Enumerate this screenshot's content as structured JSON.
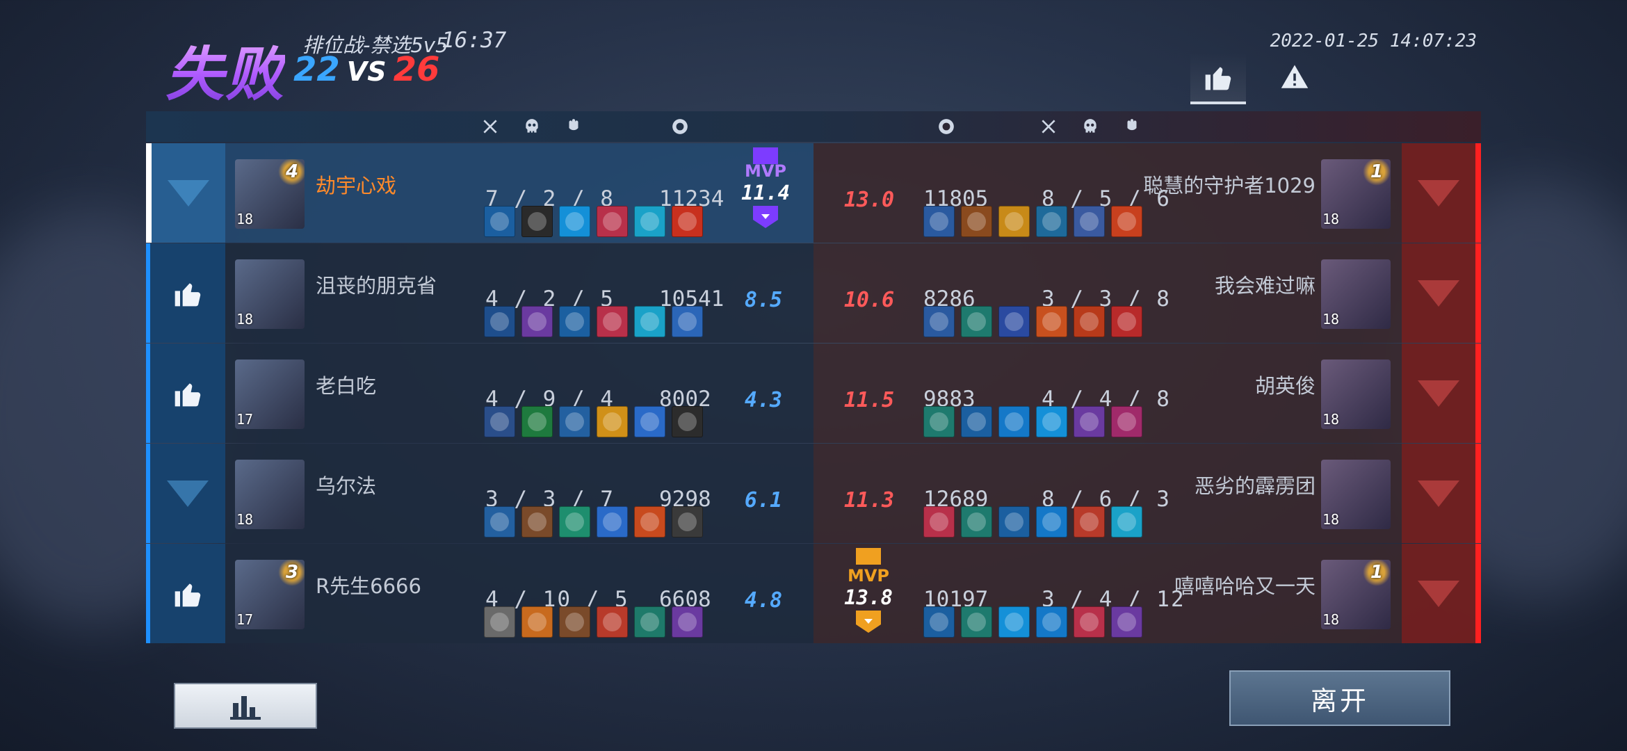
{
  "header": {
    "result": "失败",
    "mode": "排位战-禁选5v5",
    "duration": "16:37",
    "score_left": "22",
    "vs": "VS",
    "score_right": "26",
    "datetime": "2022-01-25 14:07:23"
  },
  "colors": {
    "blue_team": "#3aa6ff",
    "red_team": "#ff3b3b",
    "mvp_purple": "#7d3cff",
    "mvp_gold": "#f0a020"
  },
  "table_header_icons": [
    "kills-icon",
    "deaths-icon",
    "assists-icon",
    "gold-icon"
  ],
  "blue_team": [
    {
      "name": "劫宇心戏",
      "level": "18",
      "rank_badge": "4",
      "kda": "7 / 2 / 8",
      "gold": "11234",
      "score": "11.4",
      "mvp": "MVP",
      "self": true,
      "items": [
        "#1b5fa0",
        "#2a2a2a",
        "#1490d8",
        "#b8304a",
        "#1aa2c8",
        "#c8301e"
      ]
    },
    {
      "name": "沮丧的朋克省",
      "level": "18",
      "kda": "4 / 2 / 5",
      "gold": "10541",
      "score": "8.5",
      "items": [
        "#1e4e8c",
        "#6a3aa0",
        "#1b5fa0",
        "#b8304a",
        "#1aa2c8",
        "#2b66b8"
      ]
    },
    {
      "name": "老白吃",
      "level": "17",
      "kda": "4 / 9 / 4",
      "gold": "8002",
      "score": "4.3",
      "items": [
        "#2a4e8a",
        "#1e7a3e",
        "#2360a0",
        "#d09018",
        "#2a6ac8",
        "#2c2c2c"
      ]
    },
    {
      "name": "乌尔法",
      "level": "18",
      "kda": "3 / 3 / 7",
      "gold": "9298",
      "score": "6.1",
      "items": [
        "#2360a0",
        "#7a4a2a",
        "#1e8e6e",
        "#2a6ac8",
        "#c84a1e",
        "#3a3a3a"
      ]
    },
    {
      "name": "R先生6666",
      "level": "17",
      "rank_badge": "3",
      "kda": "4 / 10 / 5",
      "gold": "6608",
      "score": "4.8",
      "items": [
        "#6a6a6a",
        "#c86a1e",
        "#7a4a2a",
        "#b83a2a",
        "#1e7a6a",
        "#6a3aa0"
      ]
    }
  ],
  "red_team": [
    {
      "name": "聪慧的守护者1029",
      "level": "18",
      "rank_badge": "1",
      "kda": "8 / 5 / 6",
      "gold": "11805",
      "score": "13.0",
      "items": [
        "#2a5aa0",
        "#8a4a1e",
        "#c88a18",
        "#1e6a9a",
        "#3a5aa0",
        "#c8401e"
      ]
    },
    {
      "name": "我会难过嘛",
      "level": "18",
      "kda": "3 / 3 / 8",
      "gold": "8286",
      "score": "10.6",
      "items": [
        "#2a5aa0",
        "#1e7a6e",
        "#2a4aa0",
        "#c8501e",
        "#b83a1a",
        "#b82a2a"
      ]
    },
    {
      "name": "胡英俊",
      "level": "18",
      "kda": "4 / 4 / 8",
      "gold": "9883",
      "score": "11.5",
      "items": [
        "#1e7a6e",
        "#1b5fa0",
        "#1478c8",
        "#1490d8",
        "#6a3aa0",
        "#a02a6a"
      ]
    },
    {
      "name": "恶劣的霹雳团",
      "level": "18",
      "kda": "8 / 6 / 3",
      "gold": "12689",
      "score": "11.3",
      "items": [
        "#b8304a",
        "#1e7a6e",
        "#1b5fa0",
        "#1478c8",
        "#b83a2a",
        "#1aa2c8"
      ]
    },
    {
      "name": "嘻嘻哈哈又一天",
      "level": "18",
      "rank_badge": "1",
      "kda": "3 / 4 / 12",
      "gold": "10197",
      "score": "13.8",
      "mvp": "MVP",
      "items": [
        "#1b5fa0",
        "#1e7a6e",
        "#1490d8",
        "#1478c8",
        "#b8304a",
        "#6a3aa0"
      ]
    }
  ],
  "buttons": {
    "stats_icon": "bar-chart-icon",
    "leave": "离开"
  }
}
